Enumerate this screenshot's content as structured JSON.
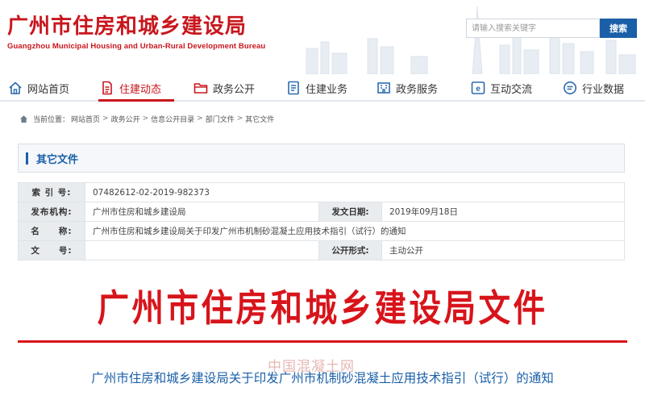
{
  "header": {
    "title": "广州市住房和城乡建设局",
    "subtitle": "Guangzhou Municipal Housing and Urban-Rural Development Bureau",
    "search": {
      "placeholder": "请输入搜索关键字",
      "button_label": "搜索"
    }
  },
  "nav": {
    "items": [
      {
        "label": "网站首页",
        "icon": "home-icon"
      },
      {
        "label": "住建动态",
        "icon": "document-icon",
        "active": true
      },
      {
        "label": "政务公开",
        "icon": "folder-icon"
      },
      {
        "label": "住建业务",
        "icon": "list-icon"
      },
      {
        "label": "政务服务",
        "icon": "building-service-icon"
      },
      {
        "label": "互动交流",
        "icon": "e-interaction-icon"
      },
      {
        "label": "行业数据",
        "icon": "chat-data-icon"
      }
    ],
    "active_color": "#c8161d"
  },
  "breadcrumb": {
    "label": "当前位置：",
    "items": [
      "网站首页",
      "政务公开",
      "信息公开目录",
      "部门文件",
      "其它文件"
    ],
    "separator": ">"
  },
  "section": {
    "title": "其它文件"
  },
  "info": {
    "index_label": "索 引 号:",
    "index_value": "07482612-02-2019-982373",
    "org_label": "发布机构:",
    "org_value": "广州市住房和城乡建设局",
    "date_label": "发文日期:",
    "date_value": "2019年09月18日",
    "name_label": "名　　称:",
    "name_value": "广州市住房和城乡建设局关于印发广州市机制砂混凝土应用技术指引（试行）的通知",
    "docno_label": "文　　号:",
    "docno_value": "",
    "form_label": "公开形式:",
    "form_value": "主动公开"
  },
  "document": {
    "header_title": "广州市住房和城乡建设局文件",
    "watermark": "中国混凝土网",
    "subtitle": "广州市住房和城乡建设局关于印发广州市机制砂混凝土应用技术指引（试行）的通知"
  },
  "colors": {
    "brand_red": "#c8161d",
    "doc_red": "#d8141b",
    "brand_blue": "#1a5fa8"
  }
}
